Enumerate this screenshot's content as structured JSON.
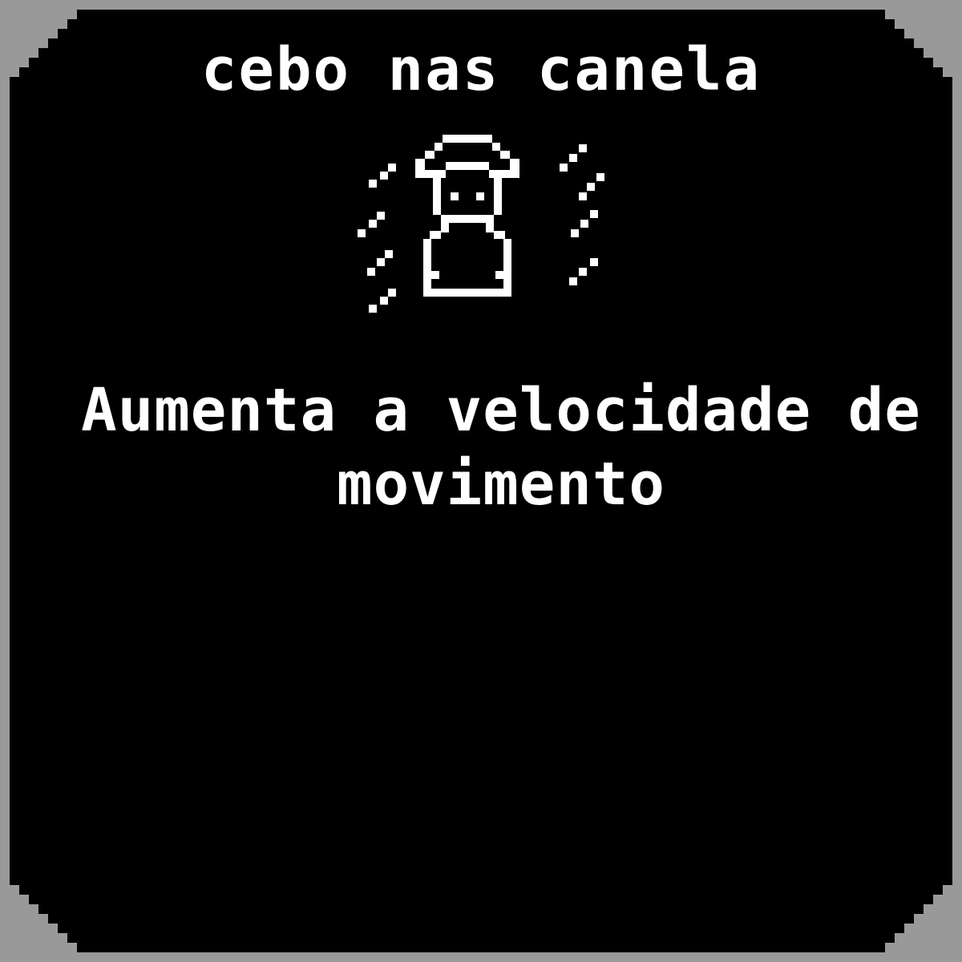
{
  "card": {
    "title": "cebo nas canela",
    "icon": "running-character-icon",
    "description": "Aumenta a velocidade de movimento"
  },
  "colors": {
    "background": "#000000",
    "border": "#999999",
    "text": "#ffffff"
  }
}
